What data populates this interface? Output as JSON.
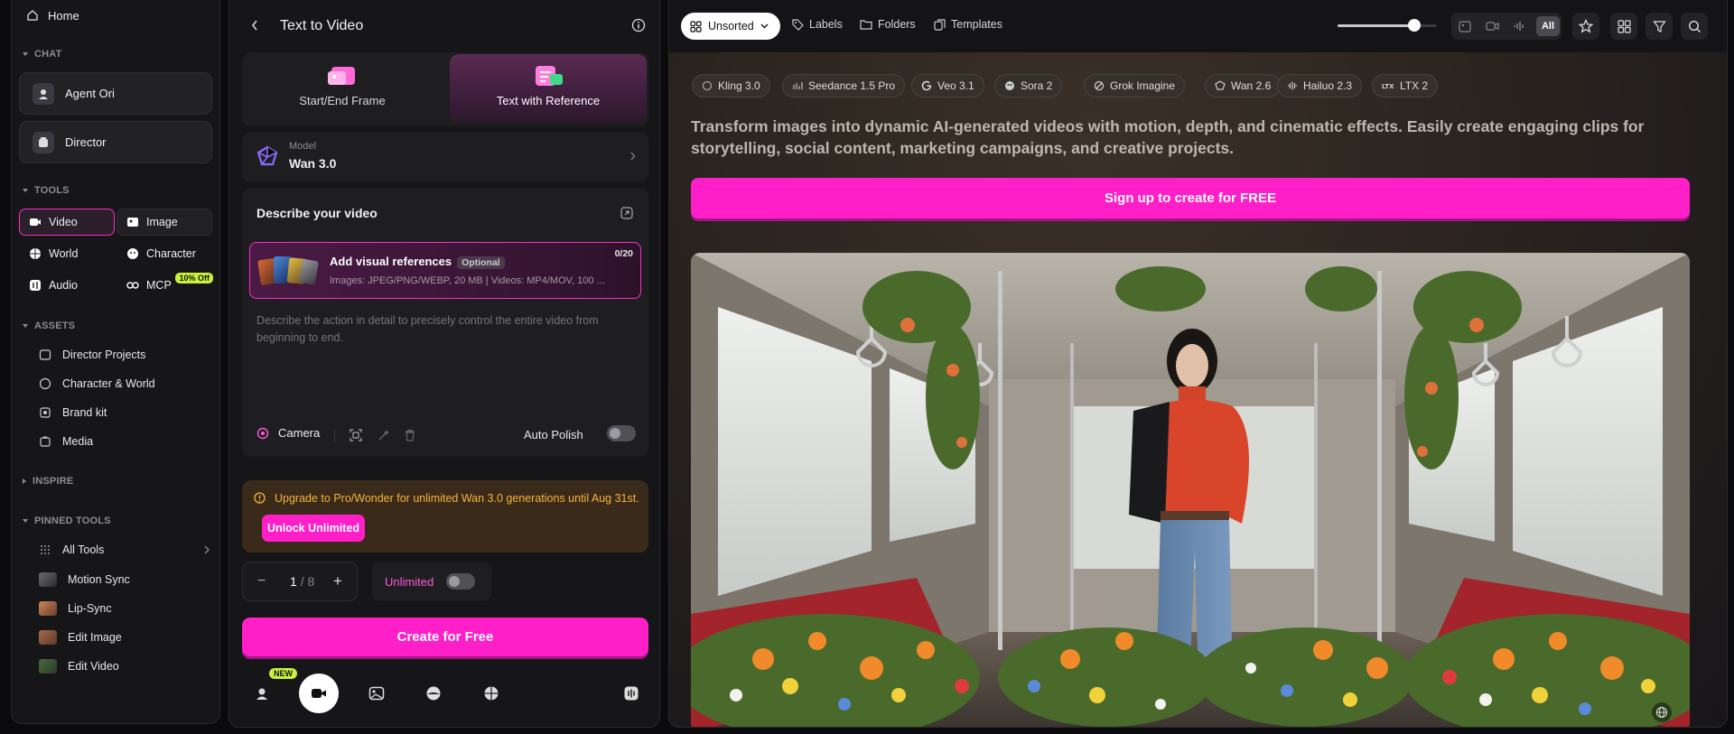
{
  "sidebar": {
    "home": "Home",
    "sections": {
      "chat": "CHAT",
      "tools": "TOOLS",
      "assets": "ASSETS",
      "inspire": "INSPIRE",
      "pinned": "PINNED TOOLS"
    },
    "chat_items": [
      "Agent Ori",
      "Director"
    ],
    "tools": [
      {
        "label": "Video",
        "icon": "video-icon",
        "active": true
      },
      {
        "label": "Image",
        "icon": "image-icon"
      },
      {
        "label": "World",
        "icon": "world-icon"
      },
      {
        "label": "Character",
        "icon": "character-icon"
      },
      {
        "label": "Audio",
        "icon": "audio-icon"
      },
      {
        "label": "MCP",
        "icon": "link-icon",
        "badge": "10% Off"
      }
    ],
    "assets": [
      "Director Projects",
      "Character & World",
      "Brand kit",
      "Media"
    ],
    "pinned": [
      "All Tools",
      "Motion Sync",
      "Lip-Sync",
      "Edit Image",
      "Edit Video"
    ]
  },
  "panel": {
    "title": "Text to Video",
    "modes": [
      "Start/End Frame",
      "Text with Reference"
    ],
    "model_label": "Model",
    "model_value": "Wan 3.0",
    "describe_title": "Describe your video",
    "ref_title": "Add visual references",
    "ref_optional": "Optional",
    "ref_count": "0/20",
    "ref_formats": "Images: JPEG/PNG/WEBP, 20 MB | Videos: MP4/MOV, 100 ...",
    "prompt_placeholder": "Describe the action in detail to precisely control the entire video from beginning to end.",
    "camera_label": "Camera",
    "auto_polish": "Auto Polish",
    "upgrade_text": "Upgrade to Pro/Wonder for unlimited Wan 3.0 generations until Aug 31st.",
    "unlock_label": "Unlock Unlimited",
    "count_value": "1",
    "count_max": "/ 8",
    "unlimited_label": "Unlimited",
    "create_label": "Create for Free",
    "new_badge": "NEW"
  },
  "gallery": {
    "sort_label": "Unsorted",
    "links": [
      "Labels",
      "Folders",
      "Templates"
    ],
    "slider_value": 0.77,
    "filter_all": "All",
    "models": [
      "Kling 3.0",
      "Seedance 1.5 Pro",
      "Veo 3.1",
      "Sora 2",
      "Grok Imagine",
      "Wan 2.6",
      "Hailuo 2.3",
      "LTX 2"
    ],
    "hero": "Transform images into dynamic AI-generated videos with motion, depth, and cinematic effects. Easily create engaging clips for storytelling, social content, marketing campaigns, and creative projects.",
    "signup_label": "Sign up to create for FREE"
  },
  "colors": {
    "accent": "#ff1fc8",
    "badge": "#c8f33a",
    "warning": "#f5b53a"
  }
}
